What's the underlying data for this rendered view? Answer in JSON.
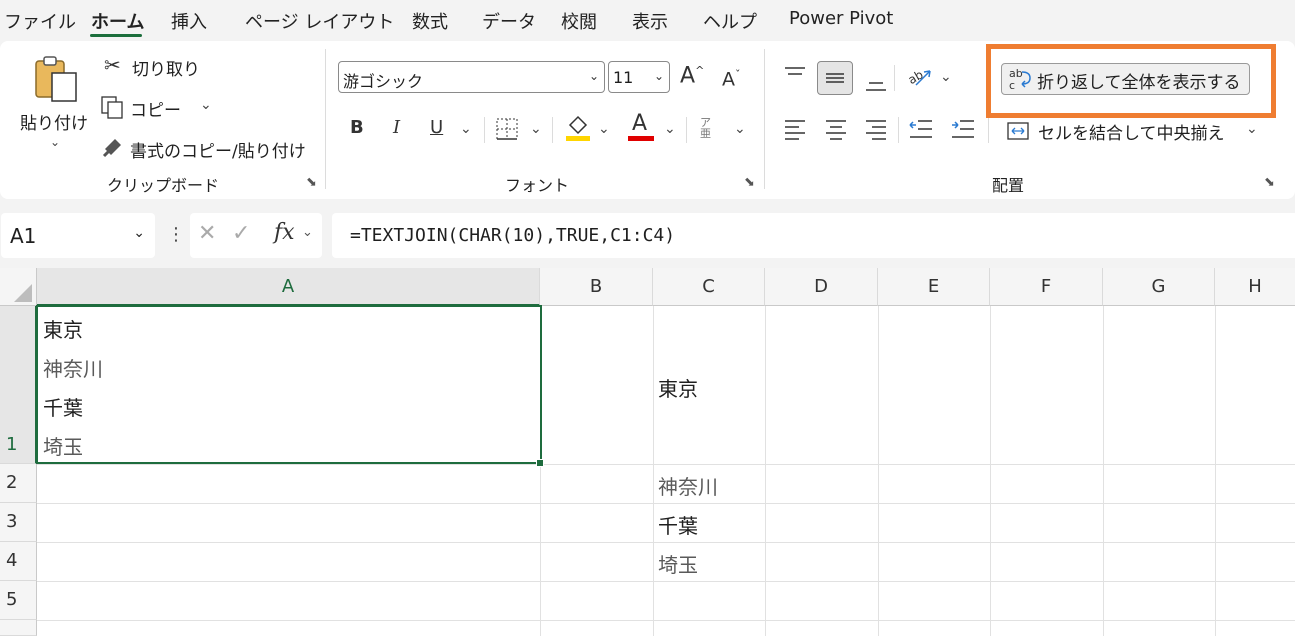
{
  "menu": {
    "items": [
      "ファイル",
      "ホーム",
      "挿入",
      "ページ レイアウト",
      "数式",
      "データ",
      "校閲",
      "表示",
      "ヘルプ",
      "Power Pivot"
    ],
    "active": "ホーム"
  },
  "ribbon": {
    "clipboard": {
      "paste": "貼り付け",
      "cut": "切り取り",
      "copy": "コピー",
      "format_painter": "書式のコピー/貼り付け",
      "label": "クリップボード"
    },
    "font": {
      "name": "游ゴシック",
      "size": "11",
      "bold": "B",
      "italic": "I",
      "underline": "U",
      "grow": "A",
      "shrink": "A",
      "color_letter": "A",
      "label": "フォント"
    },
    "alignment": {
      "wrap_text": "折り返して全体を表示する",
      "merge_center": "セルを結合して中央揃え",
      "label": "配置"
    }
  },
  "formula_bar": {
    "name_box": "A1",
    "fx": "fx",
    "formula": "=TEXTJOIN(CHAR(10),TRUE,C1:C4)"
  },
  "sheet": {
    "columns": [
      "A",
      "B",
      "C",
      "D",
      "E",
      "F",
      "G",
      "H"
    ],
    "rows": [
      "1",
      "2",
      "3",
      "4",
      "5"
    ],
    "cells": {
      "A1": [
        "東京",
        "神奈川",
        "千葉",
        "埼玉"
      ],
      "C1": "東京",
      "C2": "神奈川",
      "C3": "千葉",
      "C4": "埼玉"
    }
  },
  "colors": {
    "accent_green": "#1e6c3e",
    "highlight_orange": "#ef7d31",
    "fill_yellow": "#ffd500",
    "font_red": "#e00000"
  }
}
